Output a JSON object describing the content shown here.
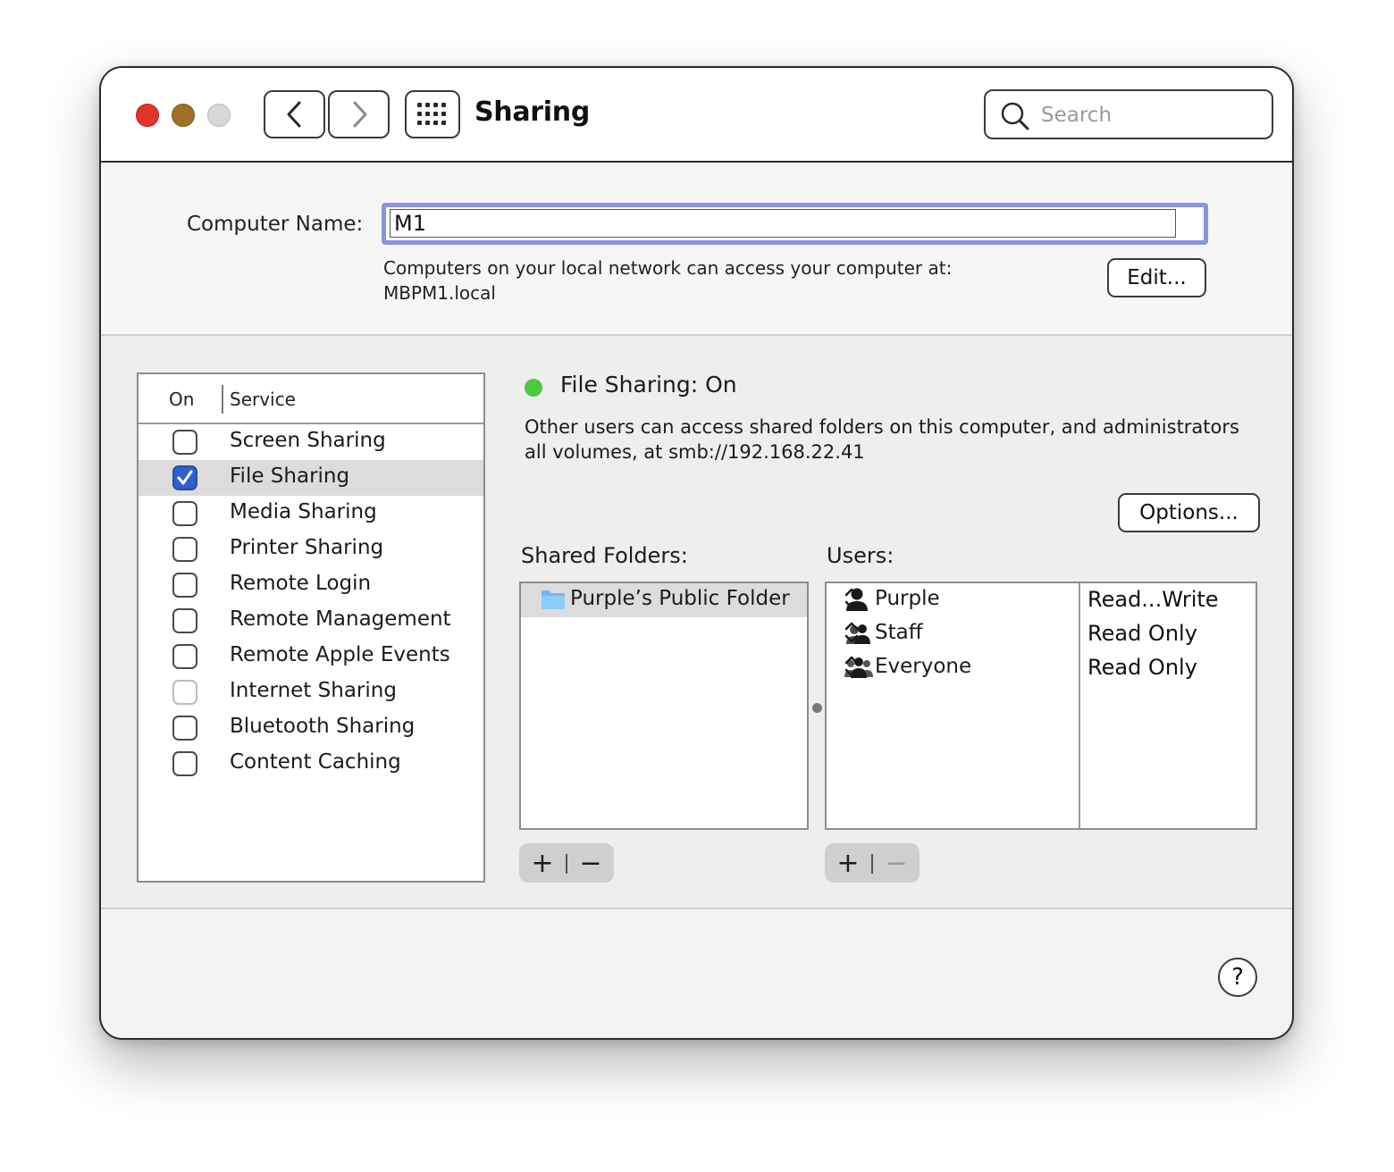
{
  "window": {
    "title": "Sharing",
    "search_placeholder": "Search"
  },
  "computer_name": {
    "label": "Computer Name:",
    "value": "M1",
    "network_line1": "Computers on your local network can access your computer at:",
    "network_line2": "MBPM1.local",
    "edit_label": "Edit..."
  },
  "services": {
    "col_on": "On",
    "col_service": "Service",
    "items": [
      {
        "label": "Screen Sharing",
        "checked": false
      },
      {
        "label": "File Sharing",
        "checked": true
      },
      {
        "label": "Media Sharing",
        "checked": false
      },
      {
        "label": "Printer Sharing",
        "checked": false
      },
      {
        "label": "Remote Login",
        "checked": false
      },
      {
        "label": "Remote Management",
        "checked": false
      },
      {
        "label": "Remote Apple Events",
        "checked": false
      },
      {
        "label": "Internet Sharing",
        "checked": false
      },
      {
        "label": "Bluetooth Sharing",
        "checked": false
      },
      {
        "label": "Content Caching",
        "checked": false
      }
    ]
  },
  "detail": {
    "status": "File Sharing: On",
    "status_color": "#4cc940",
    "description_line1": "Other users can access shared folders on this computer, and administrators",
    "description_line2": "all volumes, at smb://192.168.22.41",
    "options_label": "Options...",
    "shared_folders_label": "Shared Folders:",
    "users_label": "Users:",
    "shared_folders": [
      {
        "name": "Purple’s Public Folder",
        "icon": "folder-icon"
      }
    ],
    "users": [
      {
        "name": "Purple",
        "permission": "Read...Write",
        "icon": "user-icon"
      },
      {
        "name": "Staff",
        "permission": "Read Only",
        "icon": "group-icon"
      },
      {
        "name": "Everyone",
        "permission": "Read Only",
        "icon": "everyone-icon"
      }
    ],
    "plus": "+",
    "minus": "−"
  },
  "help": "?",
  "colors": {
    "accent": "#2f5fd0",
    "focus_ring": "#8a94dc",
    "close": "#e2332b",
    "minimize": "#9f7128",
    "zoom": "#d8d8d8"
  }
}
